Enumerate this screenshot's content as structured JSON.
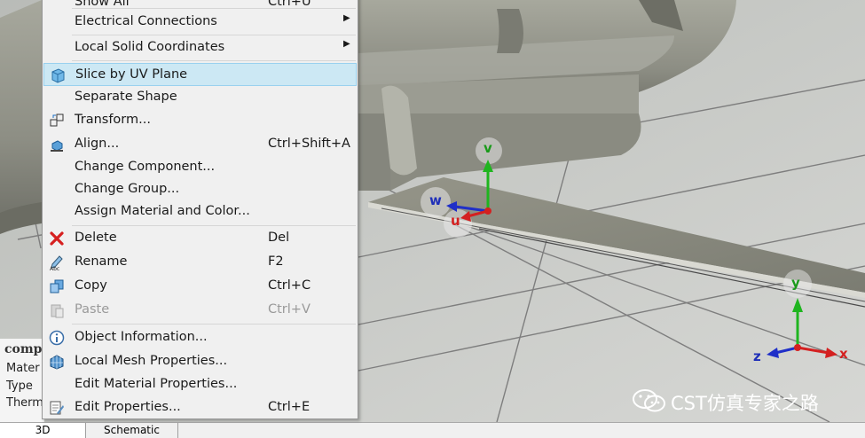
{
  "menu": {
    "items": [
      {
        "label": "Show All",
        "shortcut": "Ctrl+U",
        "submenu": false,
        "icon": "none"
      },
      {
        "label": "Electrical Connections",
        "shortcut": "",
        "submenu": true,
        "icon": "none"
      },
      {
        "label": "Local Solid Coordinates",
        "shortcut": "",
        "submenu": true,
        "icon": "none"
      },
      {
        "label": "Slice by UV Plane",
        "shortcut": "",
        "submenu": false,
        "icon": "slice-icon",
        "highlighted": true
      },
      {
        "label": "Separate Shape",
        "shortcut": "",
        "submenu": false,
        "icon": "none"
      },
      {
        "label": "Transform...",
        "shortcut": "",
        "submenu": false,
        "icon": "transform-icon"
      },
      {
        "label": "Align...",
        "shortcut": "Ctrl+Shift+A",
        "submenu": false,
        "icon": "align-icon"
      },
      {
        "label": "Change Component...",
        "shortcut": "",
        "submenu": false,
        "icon": "none"
      },
      {
        "label": "Change Group...",
        "shortcut": "",
        "submenu": false,
        "icon": "none"
      },
      {
        "label": "Assign Material and Color...",
        "shortcut": "",
        "submenu": false,
        "icon": "none"
      },
      {
        "label": "Delete",
        "shortcut": "Del",
        "submenu": false,
        "icon": "delete-icon"
      },
      {
        "label": "Rename",
        "shortcut": "F2",
        "submenu": false,
        "icon": "rename-icon"
      },
      {
        "label": "Copy",
        "shortcut": "Ctrl+C",
        "submenu": false,
        "icon": "copy-icon"
      },
      {
        "label": "Paste",
        "shortcut": "Ctrl+V",
        "submenu": false,
        "icon": "paste-icon",
        "disabled": true
      },
      {
        "label": "Object Information...",
        "shortcut": "",
        "submenu": false,
        "icon": "info-icon"
      },
      {
        "label": "Local Mesh Properties...",
        "shortcut": "",
        "submenu": false,
        "icon": "mesh-icon"
      },
      {
        "label": "Edit Material Properties...",
        "shortcut": "",
        "submenu": false,
        "icon": "none"
      },
      {
        "label": "Edit Properties...",
        "shortcut": "Ctrl+E",
        "submenu": false,
        "icon": "edit-properties-icon"
      }
    ]
  },
  "properties": {
    "title": "compo",
    "rows": [
      "Mater",
      "Type",
      "Therm"
    ]
  },
  "tabs": [
    "3D",
    "Schematic"
  ],
  "viewport": {
    "local_axes": {
      "u": "u",
      "v": "v",
      "w": "w"
    },
    "global_axes": {
      "x": "x",
      "y": "y",
      "z": "z"
    },
    "colors": {
      "x_axis": "#e03030",
      "y_axis": "#20c020",
      "z_axis": "#2040d0",
      "background": "#c9cbc8",
      "model": "#8f8f85"
    }
  },
  "watermark": "CST仿真专家之路"
}
